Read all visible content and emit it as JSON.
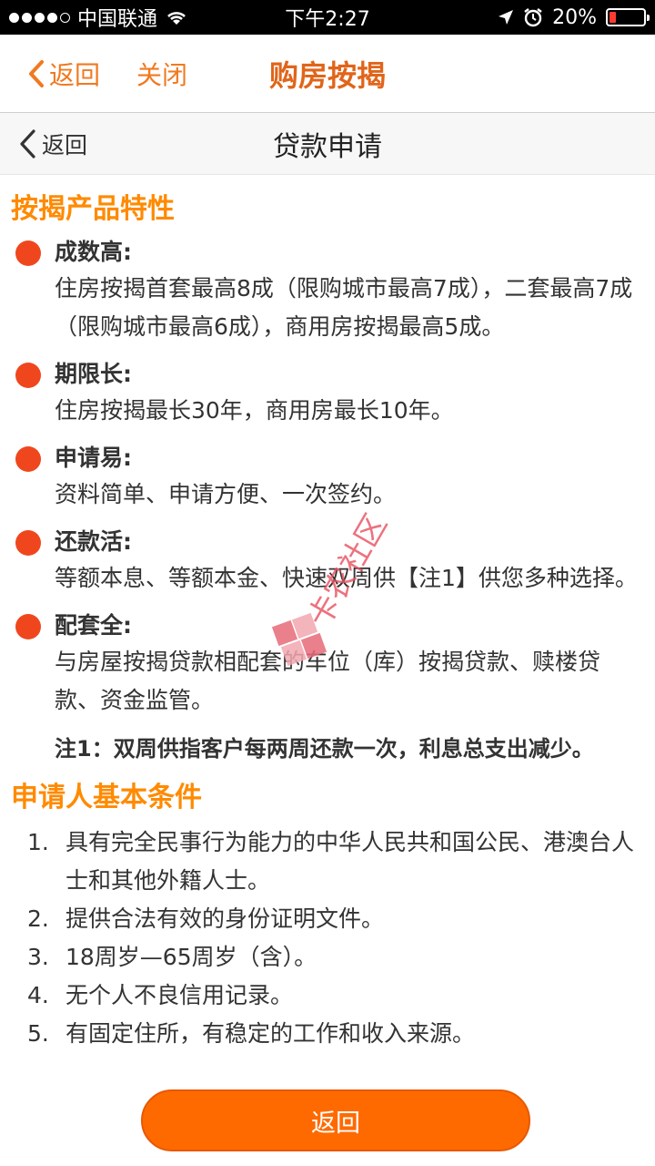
{
  "status_bar": {
    "carrier": "中国联通",
    "time": "下午2:27",
    "battery": "20%",
    "battery_level": 0.2
  },
  "app_header": {
    "back_label": "返回",
    "close_label": "关闭",
    "title": "购房按揭"
  },
  "sub_header": {
    "back_label": "返回",
    "title": "贷款申请"
  },
  "features_section": {
    "title": "按揭产品特性",
    "items": [
      {
        "title": "成数高:",
        "desc": "住房按揭首套最高8成（限购城市最高7成），二套最高7成（限购城市最高6成），商用房按揭最高5成。"
      },
      {
        "title": "期限长:",
        "desc": "住房按揭最长30年，商用房最长10年。"
      },
      {
        "title": "申请易:",
        "desc": "资料简单、申请方便、一次签约。"
      },
      {
        "title": "还款活:",
        "desc": "等额本息、等额本金、快速双周供【注1】供您多种选择。"
      },
      {
        "title": "配套全:",
        "desc": "与房屋按揭贷款相配套的车位（库）按揭贷款、赎楼贷款、资金监管。"
      }
    ],
    "note": "注1：双周供指客户每两周还款一次，利息总支出减少。"
  },
  "conditions_section": {
    "title": "申请人基本条件",
    "items": [
      {
        "num": "1.",
        "text": "具有完全民事行为能力的中华人民共和国公民、港澳台人士和其他外籍人士。"
      },
      {
        "num": "2.",
        "text": "提供合法有效的身份证明文件。"
      },
      {
        "num": "3.",
        "text": "18周岁—65周岁（含）。"
      },
      {
        "num": "4.",
        "text": "无个人不良信用记录。"
      },
      {
        "num": "5.",
        "text": "有固定住所，有稳定的工作和收入来源。"
      }
    ]
  },
  "footer": {
    "back_button_label": "返回"
  },
  "watermark": {
    "text": "卡农社区"
  },
  "colors": {
    "accent": "#f07a20",
    "section_title": "#ff8a00",
    "bullet": "#f0461e",
    "button": "#ff6a00"
  }
}
